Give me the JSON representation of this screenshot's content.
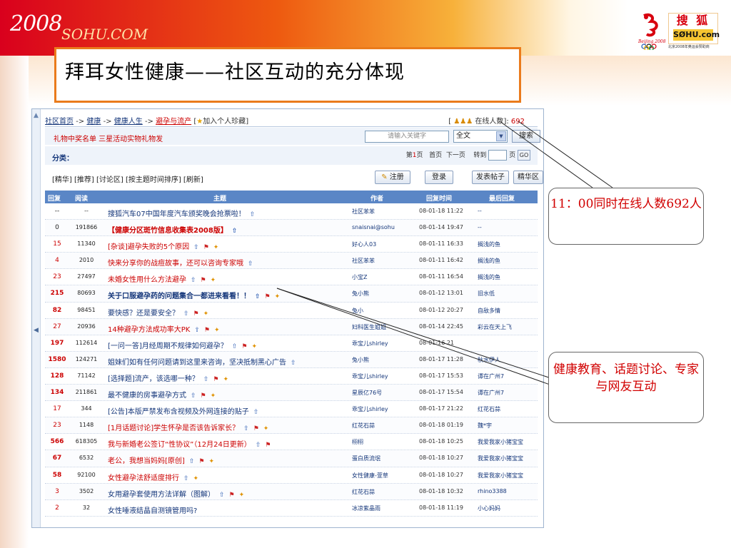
{
  "banner": {
    "brand_text": "2008",
    "brand_site": "SOHU.COM",
    "sohu_logo_cn": "搜 狐",
    "sohu_logo_en": "SØHU.com",
    "sponsor_line": "北京2008年奥运会赞助商",
    "olympic_emblem": "beijing-2008-emblem",
    "colors": {
      "banner_red": "#d9001d",
      "banner_orange": "#ee5a10",
      "title_border": "#ea7b1c",
      "callout_text": "#d10000"
    }
  },
  "slide_title": "拜耳女性健康——社区互动的充分体现",
  "forum": {
    "breadcrumb": {
      "home": "社区首页",
      "sep": "->",
      "health": "健康",
      "life": "健康人生",
      "board": "避孕与流产",
      "fav": "加入个人珍藏",
      "online_label": "在线人数",
      "online_count": "692"
    },
    "prize_text": "礼物中奖名单 三星活动实物礼物发",
    "search": {
      "placeholder": "请输入关键字",
      "scope": "全文",
      "button": "搜索"
    },
    "category_label": "分类：",
    "pager": {
      "prefix": "第",
      "current": "1",
      "suffix": "页",
      "first": "首页",
      "next": "下一页",
      "goto": "转到",
      "page": "页",
      "go": "GO"
    },
    "filters": "[精华] [推荐] [讨论区] [按主题时间排序] [刷新]",
    "buttons": {
      "register": "注册",
      "login": "登录",
      "post": "发表帖子",
      "digest": "精华区"
    },
    "headers": {
      "reply": "回复",
      "read": "阅读",
      "topic": "主题",
      "author": "作者",
      "reply_time": "回复时间",
      "last_reply": "最后回复"
    },
    "rows": [
      {
        "reply": "--",
        "read": "--",
        "topic": "搜狐汽车07中国年度汽车颁奖晚会抢票啦！",
        "author": "社区苯苯",
        "time": "08-01-18 11:22",
        "last": "--"
      },
      {
        "reply": "0",
        "read": "191866",
        "topic": "【健康分区斑竹信息收集表2008版】",
        "author": "snaisnai@sohu",
        "time": "08-01-14 19:47",
        "last": "--"
      },
      {
        "reply": "15",
        "read": "11340",
        "topic": "[杂谈]避孕失败的5个原因",
        "author": "好心人03",
        "time": "08-01-11 16:33",
        "last": "搁浅的鱼"
      },
      {
        "reply": "4",
        "read": "2010",
        "topic": "快来分享你的战痘故事，还可以咨询专家哦",
        "author": "社区苯苯",
        "time": "08-01-11 16:42",
        "last": "搁浅的鱼"
      },
      {
        "reply": "23",
        "read": "27497",
        "topic": "未婚女性用什么方法避孕",
        "author": "小宝Z",
        "time": "08-01-11 16:54",
        "last": "搁浅的鱼"
      },
      {
        "reply": "215",
        "read": "80693",
        "topic": "关于口服避孕药的问题集合一都进来看看！！",
        "author": "兔小熊",
        "time": "08-01-12 13:01",
        "last": "旧水低"
      },
      {
        "reply": "82",
        "read": "98451",
        "topic": "要快感？还是要安全？",
        "author": "兔小",
        "time": "08-01-12 20:27",
        "last": "自敌多情"
      },
      {
        "reply": "27",
        "read": "20936",
        "topic": "14种避孕方法成功率大PK",
        "author": "妇科医生姐姐",
        "time": "08-01-14 22:45",
        "last": "彩云在天上飞"
      },
      {
        "reply": "197",
        "read": "112614",
        "topic": "[一问一答]月经周期不规律如何避孕？",
        "author": "乖宝儿shirley",
        "time": "08-01-16 21",
        "last": ""
      },
      {
        "reply": "1580",
        "read": "124271",
        "topic": "姐妹们如有任何问题请到这里来咨询，坚决抵制黑心广告",
        "author": "兔小熊",
        "time": "08-01-17 11:28",
        "last": "秋水伊人"
      },
      {
        "reply": "128",
        "read": "71142",
        "topic": "[选择题]流产，该选哪一种？",
        "author": "乖宝儿shirley",
        "time": "08-01-17 15:53",
        "last": "谭在广州7"
      },
      {
        "reply": "134",
        "read": "211861",
        "topic": "最不健康的房事避孕方式",
        "author": "星辰亿76号",
        "time": "08-01-17 15:54",
        "last": "谭在广州7"
      },
      {
        "reply": "17",
        "read": "344",
        "topic": "[公告]本版严禁发布含视频及外网连接的贴子",
        "author": "乖宝儿shirley",
        "time": "08-01-17 21:22",
        "last": "红花石蒜"
      },
      {
        "reply": "23",
        "read": "1148",
        "topic": "[1月话题讨论]学生怀孕是否该告诉家长？",
        "author": "红花石蒜",
        "time": "08-01-18 01:19",
        "last": "魏*宇"
      },
      {
        "reply": "566",
        "read": "618305",
        "topic": "我与新婚老公签订“性协议”（12月24日更新）",
        "author": "栩栩",
        "time": "08-01-18 10:25",
        "last": "我爱我家小猪宝宝"
      },
      {
        "reply": "67",
        "read": "6532",
        "topic": "老公，我想当妈妈[原创]",
        "author": "蛋白质流氓",
        "time": "08-01-18 10:27",
        "last": "我爱我家小猪宝宝"
      },
      {
        "reply": "58",
        "read": "92100",
        "topic": "女性避孕法舒适度排行",
        "author": "女性健康-萱草",
        "time": "08-01-18 10:27",
        "last": "我爱我家小猪宝宝"
      },
      {
        "reply": "3",
        "read": "3502",
        "topic": "女用避孕套使用方法详解（图解）",
        "author": "红花石蒜",
        "time": "08-01-18 10:32",
        "last": "rhino3388"
      },
      {
        "reply": "2",
        "read": "32",
        "topic": "女性唾液结晶自测镜管用吗?",
        "author": "冰凉紫晶雨",
        "time": "08-01-18 11:19",
        "last": "小心妈妈"
      }
    ]
  },
  "callouts": {
    "online": "11：00同时在线人数692人",
    "interaction": "健康教育、话题讨论、专家与网友互动"
  }
}
